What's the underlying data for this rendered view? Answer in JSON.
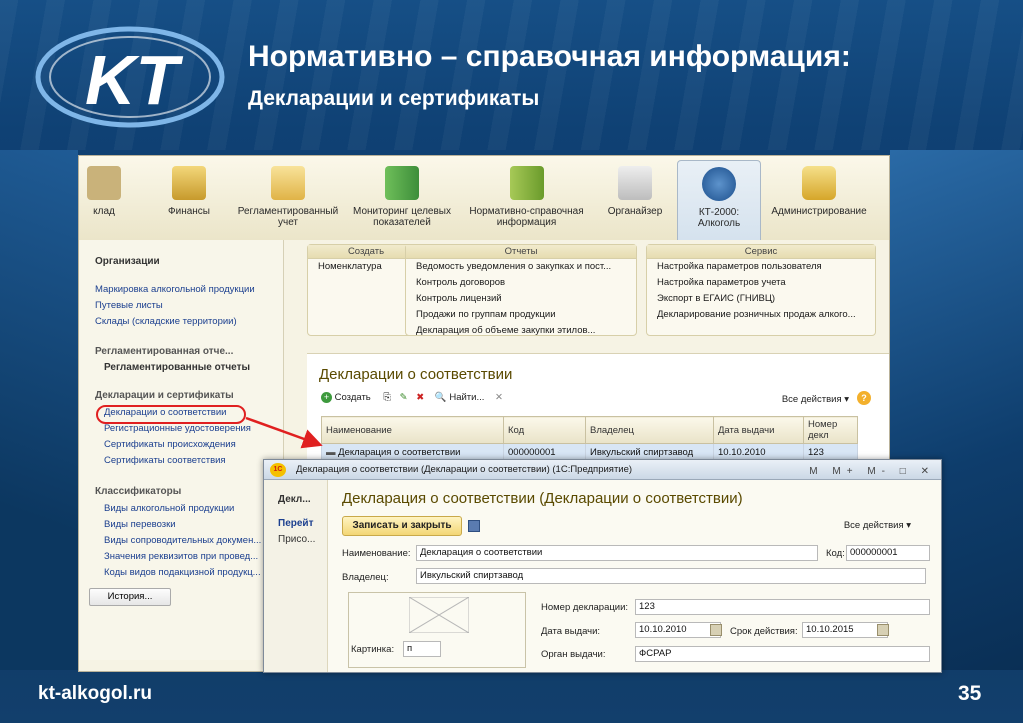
{
  "slide": {
    "title": "Нормативно – справочная информация:",
    "subtitle": "Декларации и сертификаты",
    "footer_url": "kt-alkogol.ru",
    "page_number": "35",
    "logo_text": "KT"
  },
  "toolbar": {
    "items": [
      {
        "label": "клад"
      },
      {
        "label": "Финансы"
      },
      {
        "label": "Регламентированный учет"
      },
      {
        "label": "Мониторинг целевых показателей"
      },
      {
        "label": "Нормативно-справочная информация"
      },
      {
        "label": "Органайзер"
      },
      {
        "label": "КТ-2000: Алкоголь"
      },
      {
        "label": "Администрирование"
      }
    ]
  },
  "left_panel": {
    "org_title": "Организации",
    "items1": [
      "Маркировка алкогольной продукции",
      "Путевые листы",
      "Склады (складские территории)"
    ],
    "reg_group": "Регламентированная отче...",
    "reg_item": "Регламентированные отчеты",
    "decl_group": "Декларации и сертификаты",
    "decl_items": [
      "Декларации о соответствии",
      "Регистрационные удостоверения",
      "Сертификаты происхождения",
      "Сертификаты соответствия"
    ],
    "class_group": "Классификаторы",
    "class_items": [
      "Виды алкогольной продукции",
      "Виды перевозки",
      "Виды сопроводительных докумен...",
      "Значения реквизитов при провед...",
      "Коды видов подакцизной продукц..."
    ],
    "history_button": "История..."
  },
  "groups": {
    "create": {
      "header": "Создать",
      "items": [
        "Номенклатура"
      ]
    },
    "reports": {
      "header": "Отчеты",
      "items": [
        "Ведомость уведомления о закупках и пост...",
        "Контроль договоров",
        "Контроль лицензий",
        "Продажи по группам продукции",
        "Декларация об объеме закупки этилов..."
      ]
    },
    "service": {
      "header": "Сервис",
      "items": [
        "Настройка параметров пользователя",
        "Настройка параметров учета",
        "Экспорт в ЕГАИС (ГНИВЦ)",
        "Декларирование розничных продаж алкого..."
      ]
    }
  },
  "list": {
    "title": "Декларации о соответствии",
    "create_button": "Создать",
    "find_button": "Найти...",
    "all_actions": "Все действия ▾",
    "columns": [
      "Наименование",
      "Код",
      "Владелец",
      "Дата выдачи",
      "Номер декл"
    ],
    "rows": [
      {
        "name": "Декларация о соответствии",
        "code": "000000001",
        "owner": "Ивкульский спиртзавод",
        "date": "10.10.2010",
        "number": "123"
      }
    ]
  },
  "form": {
    "window_title": "Декларация о соответствии (Декларации о соответствии) (1С:Предприятие)",
    "window_buttons": "M M+ M- □ ✕",
    "side_items": [
      "Декл...",
      "Перейт",
      "Присо..."
    ],
    "title": "Декларация о соответствии (Декларации о соответствии)",
    "save_close_button": "Записать и закрыть",
    "all_actions": "Все действия ▾",
    "name_label": "Наименование:",
    "name_value": "Декларация о соответствии",
    "code_label": "Код:",
    "code_value": "000000001",
    "owner_label": "Владелец:",
    "owner_value": "Ивкульский спиртзавод",
    "decl_number_label": "Номер декларации:",
    "decl_number_value": "123",
    "issue_date_label": "Дата выдачи:",
    "issue_date_value": "10.10.2010",
    "valid_label": "Срок действия:",
    "valid_value": "10.10.2015",
    "issuer_label": "Орган выдачи:",
    "issuer_value": "ФСРАР",
    "picture_label": "Картинка:",
    "picture_value": "п"
  },
  "colors": {
    "accent_red": "#e02020",
    "selected_row": "#d8e6f5",
    "title_text": "#5a4a00"
  }
}
